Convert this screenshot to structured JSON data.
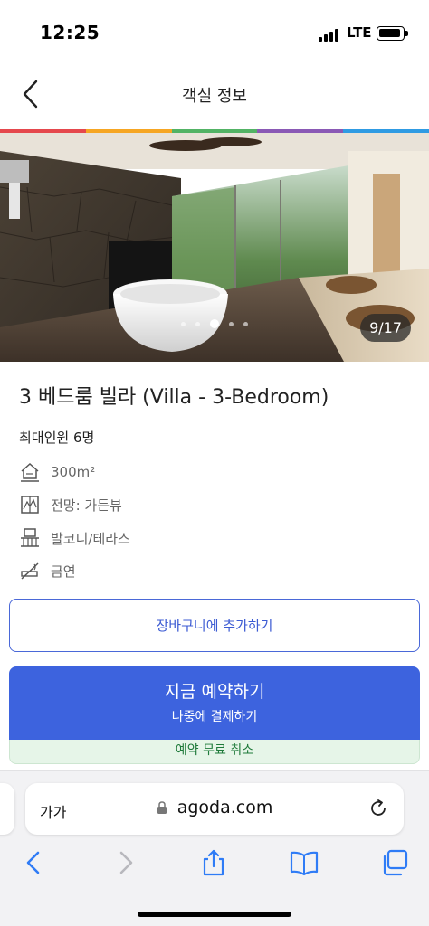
{
  "status_bar": {
    "time": "12:25",
    "network": "LTE"
  },
  "header": {
    "title": "객실 정보",
    "back_icon": "chevron-left-icon"
  },
  "brand_colors": [
    "#e5484d",
    "#f6a623",
    "#52b365",
    "#8a59b5",
    "#2f9be3"
  ],
  "photo": {
    "counter": "9/17",
    "dots_total": 5,
    "dot_active_index": 2
  },
  "room": {
    "name": "3 베드룸 빌라 (Villa - 3-Bedroom)",
    "max_occupancy": "최대인원 6명",
    "features": [
      {
        "icon": "house-size-icon",
        "label": "300m²"
      },
      {
        "icon": "window-view-icon",
        "label": "전망: 가든뷰"
      },
      {
        "icon": "balcony-icon",
        "label": "발코니/테라스"
      },
      {
        "icon": "no-smoking-icon",
        "label": "금연"
      }
    ]
  },
  "actions": {
    "add_to_cart": "장바구니에 추가하기",
    "book_now": "지금 예약하기",
    "pay_later": "나중에 결제하기",
    "free_cancellation": "예약 무료 취소"
  },
  "colors": {
    "primary": "#3d63de",
    "free_cancel_text": "#1f7a3a",
    "free_cancel_bg": "#e6f5e8"
  },
  "browser": {
    "text_size_label": "가가",
    "url": "agoda.com",
    "toolbar": [
      "back-icon",
      "forward-icon",
      "share-icon",
      "bookmarks-icon",
      "tabs-icon"
    ]
  }
}
